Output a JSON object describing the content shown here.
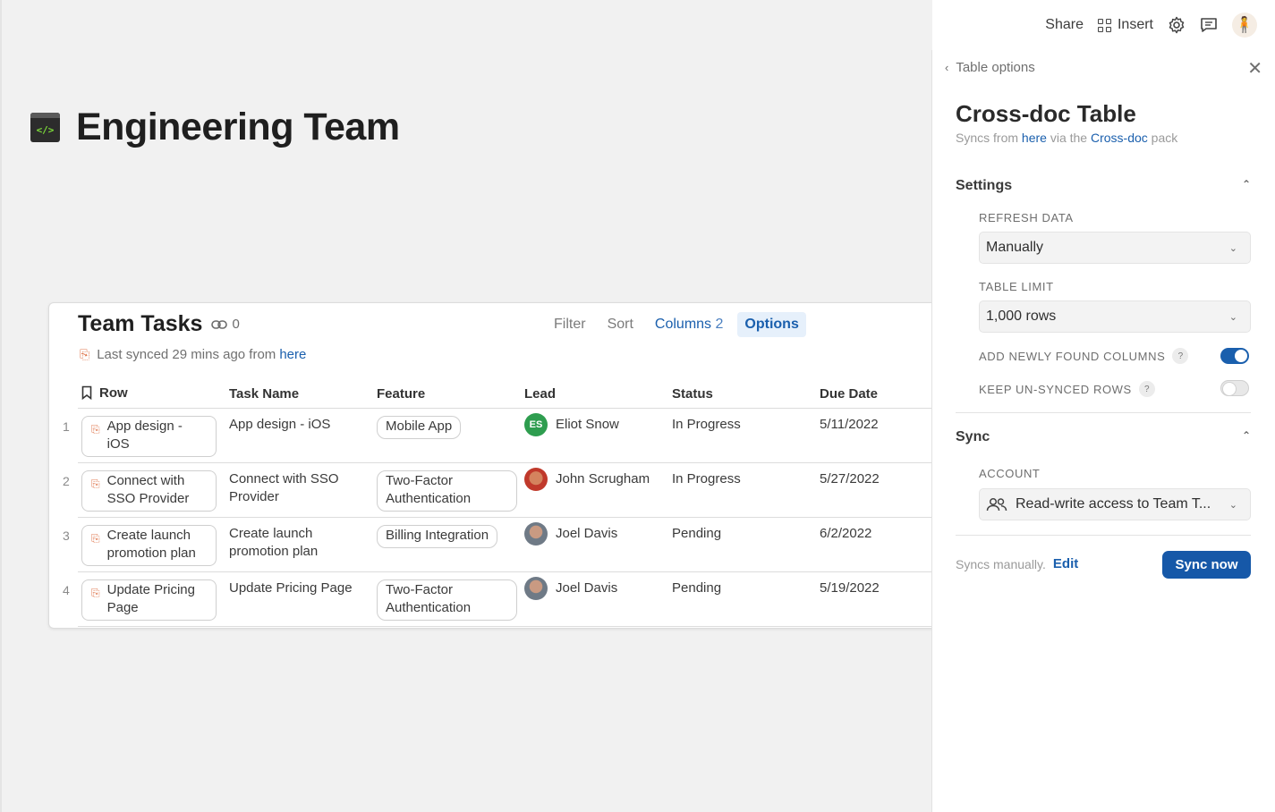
{
  "doc": {
    "icon_glyph": "</>",
    "title": "Engineering Team"
  },
  "table": {
    "title": "Team Tasks",
    "link_count": "0",
    "toolbar": {
      "filter": "Filter",
      "sort": "Sort",
      "columns": "Columns",
      "columns_count": "2",
      "options": "Options"
    },
    "synced_text": "Last synced 29 mins ago from",
    "synced_link": "here",
    "headers": [
      "Row",
      "Task Name",
      "Feature",
      "Lead",
      "Status",
      "Due Date"
    ],
    "rows": [
      {
        "num": "1",
        "row": "App design - iOS",
        "task": "App design - iOS",
        "feature": "Mobile App",
        "lead": "Eliot Snow",
        "lead_initials": "ES",
        "status": "In Progress",
        "due": "5/11/2022"
      },
      {
        "num": "2",
        "row": "Connect with SSO Provider",
        "task": "Connect with SSO Provider",
        "feature": "Two-Factor Authentication",
        "lead": "John Scrugham",
        "lead_initials": "",
        "status": "In Progress",
        "due": "5/27/2022"
      },
      {
        "num": "3",
        "row": "Create launch promotion plan",
        "task": "Create launch promotion plan",
        "feature": "Billing Integration",
        "lead": "Joel Davis",
        "lead_initials": "",
        "status": "Pending",
        "due": "6/2/2022"
      },
      {
        "num": "4",
        "row": "Update Pricing Page",
        "task": "Update Pricing Page",
        "feature": "Two-Factor Authentication",
        "lead": "Joel Davis",
        "lead_initials": "",
        "status": "Pending",
        "due": "5/19/2022"
      }
    ]
  },
  "topbar": {
    "share": "Share",
    "insert": "Insert"
  },
  "panel": {
    "breadcrumb": "Table options",
    "title": "Cross-doc Table",
    "sub_prefix": "Syncs from",
    "sub_link1": "here",
    "sub_mid": "via the",
    "sub_link2": "Cross-doc",
    "sub_suffix": "pack",
    "settings_heading": "Settings",
    "refresh_label": "REFRESH DATA",
    "refresh_value": "Manually",
    "limit_label": "TABLE LIMIT",
    "limit_value": "1,000 rows",
    "add_columns_label": "ADD NEWLY FOUND COLUMNS",
    "add_columns_on": true,
    "keep_rows_label": "KEEP UN-SYNCED ROWS",
    "keep_rows_on": false,
    "sync_heading": "Sync",
    "account_label": "ACCOUNT",
    "account_value": "Read-write access to Team T...",
    "footer_text": "Syncs manually.",
    "edit_label": "Edit",
    "sync_now_label": "Sync now"
  },
  "colors": {
    "accent": "#1a5fad",
    "sync_orange": "#e07a52",
    "avatar_es": "#2e9d4f"
  }
}
